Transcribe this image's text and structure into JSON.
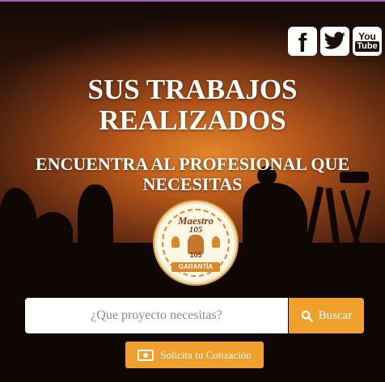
{
  "social": {
    "facebook_glyph": "f",
    "youtube_you": "You",
    "youtube_tube": "Tube"
  },
  "hero": {
    "title_line1": "SUS TRABAJOS",
    "title_line2": "REALIZADOS",
    "subtitle": "ENCUENTRA AL PROFESIONAL QUE NECESITAS"
  },
  "badge": {
    "line1": "Maestro",
    "line2": "105",
    "figure_number": "105",
    "ribbon": "GARANTÍA"
  },
  "search": {
    "placeholder": "¿Que proyecto necesitas?",
    "button_label": "Buscar"
  },
  "quote": {
    "button_label": "Solicita tu Cotización"
  },
  "colors": {
    "accent": "#f0a02c",
    "text": "#ffffff"
  },
  "icons": [
    "facebook-icon",
    "twitter-icon",
    "youtube-icon",
    "search-icon",
    "money-icon"
  ]
}
